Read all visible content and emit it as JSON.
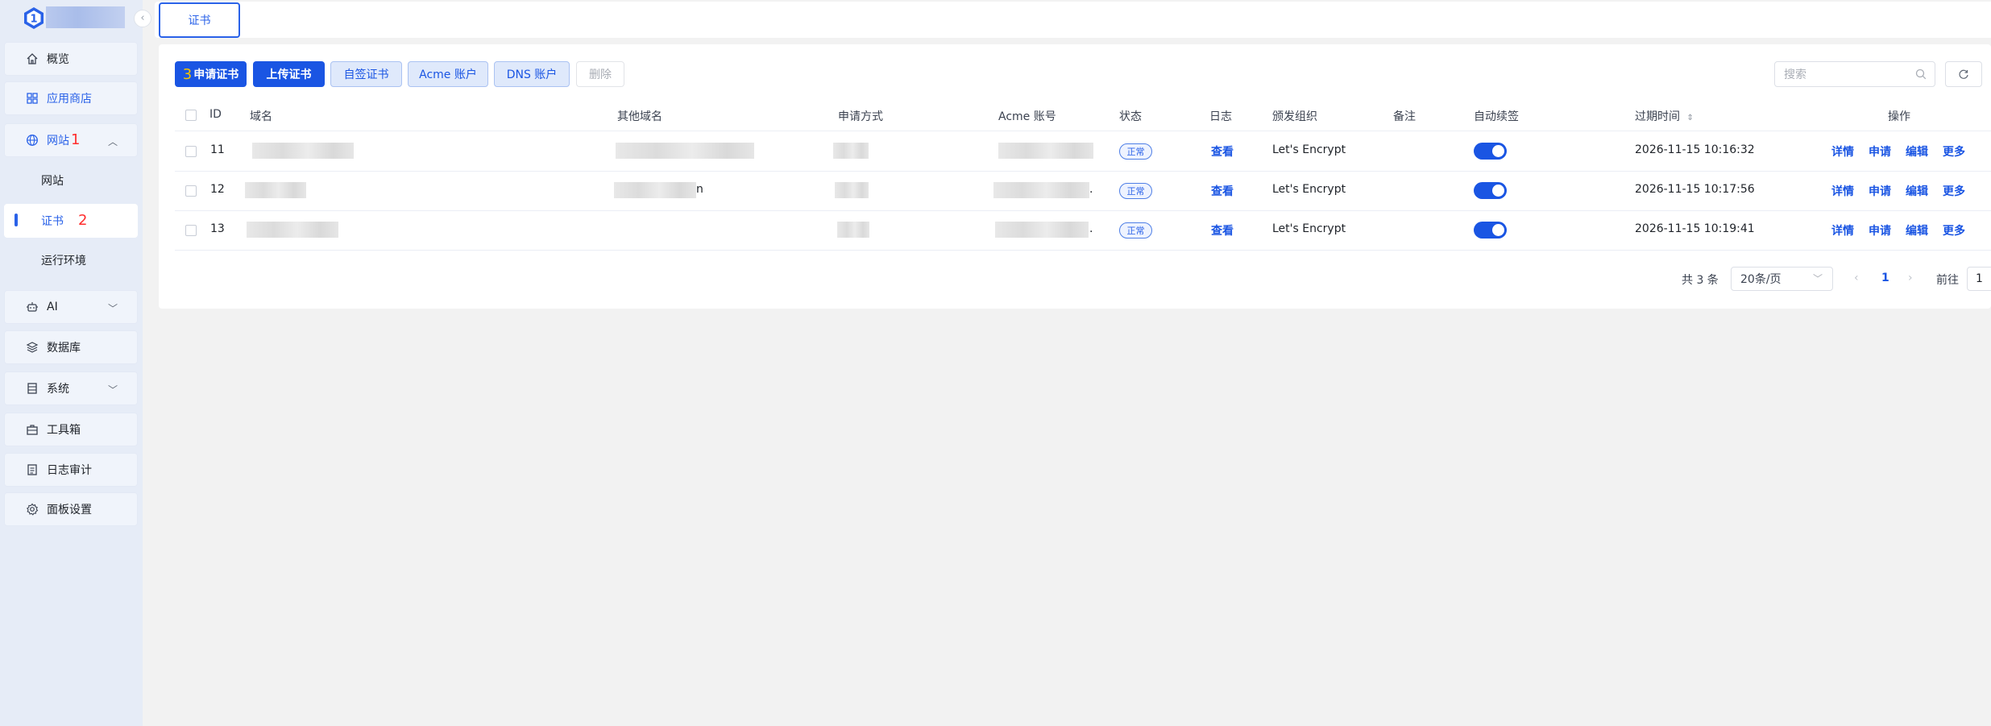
{
  "sidebar": {
    "collapse_icon": "chevron-left-icon",
    "items": [
      {
        "label": "概览",
        "icon": "home-icon"
      },
      {
        "label": "应用商店",
        "icon": "grid-icon"
      },
      {
        "label": "网站",
        "icon": "globe-icon",
        "annotation": "1"
      },
      {
        "label": "网站"
      },
      {
        "label": "证书",
        "annotation": "2"
      },
      {
        "label": "运行环境"
      },
      {
        "label": "AI",
        "icon": "robot-icon"
      },
      {
        "label": "数据库",
        "icon": "layers-icon"
      },
      {
        "label": "系统",
        "icon": "server-icon"
      },
      {
        "label": "工具箱",
        "icon": "toolbox-icon"
      },
      {
        "label": "日志审计",
        "icon": "log-icon"
      },
      {
        "label": "面板设置",
        "icon": "gear-icon"
      }
    ]
  },
  "topbar": {
    "tab_label": "证书"
  },
  "toolbar": {
    "apply_annotation": "3",
    "apply_label": "申请证书",
    "upload_label": "上传证书",
    "self_sign_label": "自签证书",
    "acme_label": "Acme 账户",
    "dns_label": "DNS 账户",
    "delete_label": "删除",
    "search_placeholder": "搜索"
  },
  "table": {
    "headers": {
      "id": "ID",
      "domain": "域名",
      "other_domains": "其他域名",
      "method": "申请方式",
      "acme": "Acme 账号",
      "status": "状态",
      "log": "日志",
      "issuer": "颁发组织",
      "remark": "备注",
      "auto_renew": "自动续签",
      "expire": "过期时间",
      "actions": "操作"
    },
    "rows": [
      {
        "id": "11",
        "other_suffix": "",
        "acme_suffix": "",
        "status": "正常",
        "log": "查看",
        "issuer": "Let's Encrypt",
        "auto_renew": true,
        "expire": "2026-11-15 10:16:32"
      },
      {
        "id": "12",
        "other_suffix": "n",
        "acme_suffix": ".",
        "status": "正常",
        "log": "查看",
        "issuer": "Let's Encrypt",
        "auto_renew": true,
        "expire": "2026-11-15 10:17:56"
      },
      {
        "id": "13",
        "other_suffix": "",
        "acme_suffix": ".",
        "status": "正常",
        "log": "查看",
        "issuer": "Let's Encrypt",
        "auto_renew": true,
        "expire": "2026-11-15 10:19:41"
      }
    ],
    "row_actions": {
      "detail": "详情",
      "apply": "申请",
      "edit": "编辑",
      "more": "更多"
    }
  },
  "pagination": {
    "total_text": "共 3 条",
    "page_size": "20条/页",
    "current_page": "1",
    "goto_label": "前往",
    "goto_value": "1"
  }
}
